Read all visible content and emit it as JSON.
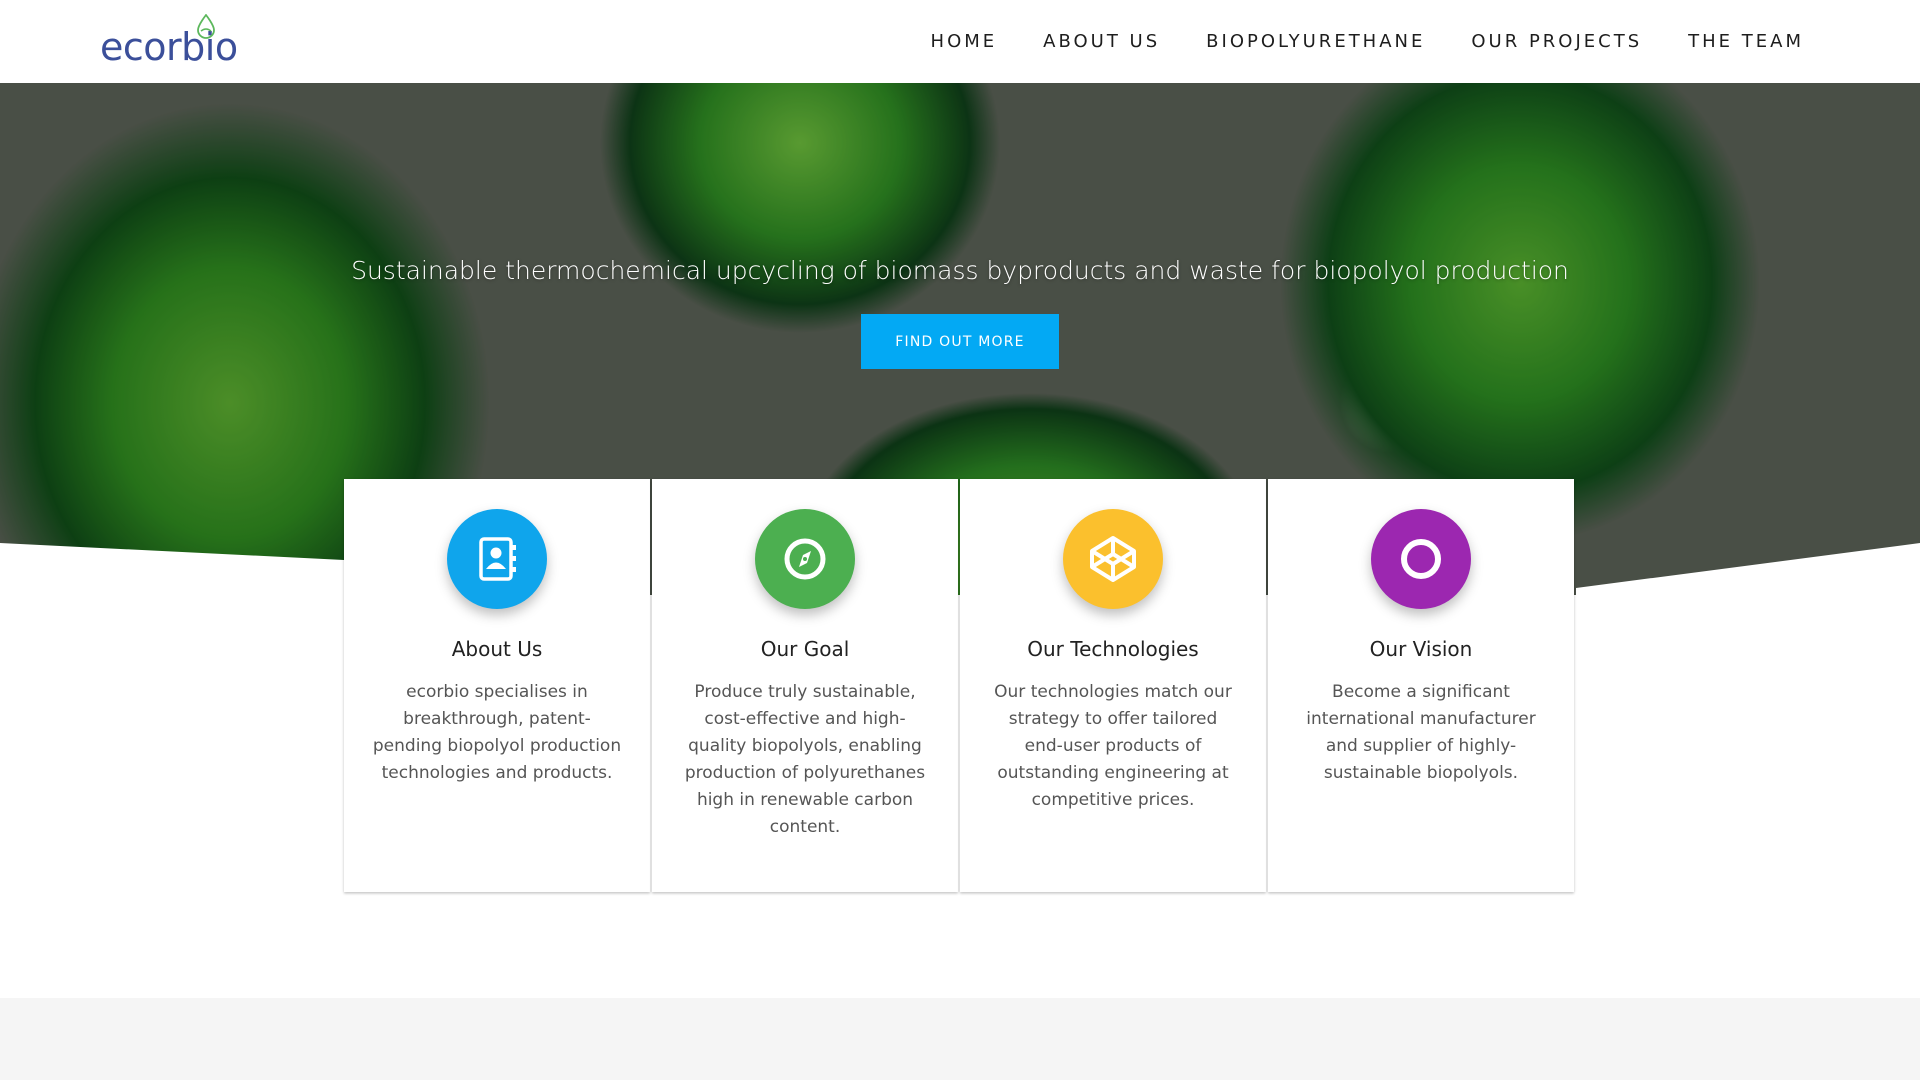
{
  "header": {
    "logo_text": "ecorbio",
    "nav": [
      {
        "label": "HOME"
      },
      {
        "label": "ABOUT US"
      },
      {
        "label": "BIOPOLYURETHANE"
      },
      {
        "label": "OUR PROJECTS"
      },
      {
        "label": "THE TEAM"
      }
    ]
  },
  "hero": {
    "tagline": "Sustainable thermochemical upcycling of biomass byproducts and waste for biopolyol production",
    "cta_label": "FIND OUT MORE"
  },
  "cards": [
    {
      "title": "About Us",
      "text": "ecorbio specialises in breakthrough, patent-pending biopolyol production technologies and products.",
      "icon": "contact-book-icon",
      "color": "#0fa5ec"
    },
    {
      "title": "Our Goal",
      "text": "Produce truly sustainable, cost-effective and high-quality biopolyols, enabling production of polyurethanes high in renewable carbon content.",
      "icon": "compass-icon",
      "color": "#4caf50"
    },
    {
      "title": "Our Technologies",
      "text": "Our technologies match our strategy to offer tailored end-user products of outstanding engineering at competitive prices.",
      "icon": "codepen-icon",
      "color": "#fbc02d"
    },
    {
      "title": "Our Vision",
      "text": "Become a significant international manufacturer and supplier of highly-sustainable biopolyols.",
      "icon": "circle-icon",
      "color": "#9c27b0"
    }
  ]
}
